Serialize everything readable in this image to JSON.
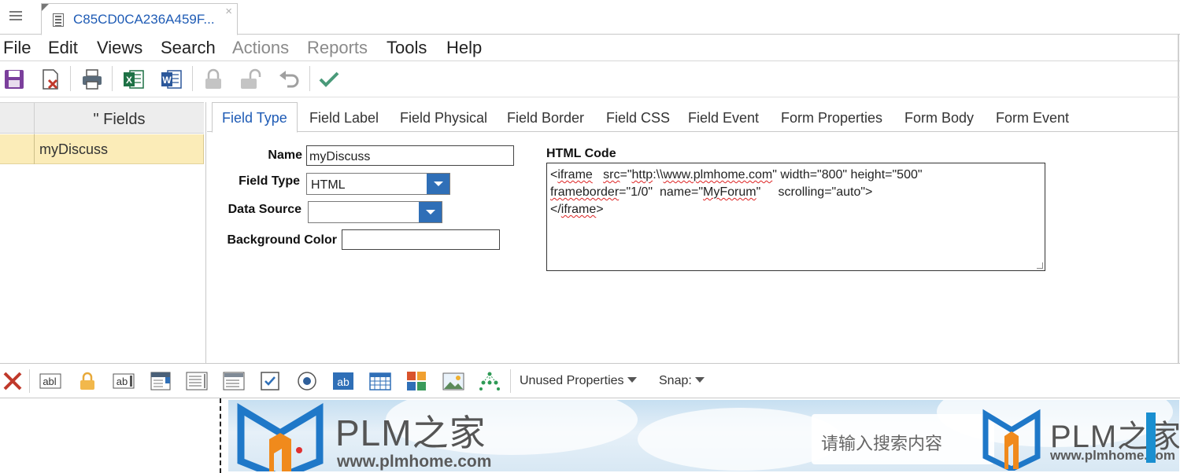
{
  "app": {
    "doc_tab_title": "C85CD0CA236A459F...",
    "close_glyph": "×"
  },
  "menu": [
    "File",
    "Edit",
    "Views",
    "Search",
    "Actions",
    "Reports",
    "Tools",
    "Help"
  ],
  "menu_disabled": [
    "Actions",
    "Reports"
  ],
  "toolbar_icons": [
    "save-icon",
    "delete-icon",
    "print-icon",
    "excel-icon",
    "word-icon",
    "lock-icon",
    "unlock-icon",
    "undo-icon",
    "check-icon"
  ],
  "fields_grid": {
    "header": "\" Fields",
    "rows": [
      "myDiscuss"
    ]
  },
  "tabs": [
    "Field Type",
    "Field Label",
    "Field Physical",
    "Field Border",
    "Field CSS",
    "Field Event",
    "Form Properties",
    "Form Body",
    "Form Event"
  ],
  "active_tab": "Field Type",
  "form": {
    "name_label": "Name",
    "name_value": "myDiscuss",
    "field_type_label": "Field Type",
    "field_type_value": "HTML",
    "data_source_label": "Data Source",
    "data_source_value": "",
    "bg_color_label": "Background Color",
    "bg_color_value": "",
    "html_code_label": "HTML Code",
    "html_code_lines": [
      "<iframe   src=\"http:\\\\www.plmhome.com\" width=\"800\" height=\"500\"",
      "frameborder=\"1/0\"  name=\"MyForum\"     scrolling=\"auto\">",
      "</iframe>"
    ]
  },
  "bottom_toolbar": {
    "icons": [
      "delete-x-icon",
      "textbox-icon",
      "lock-icon",
      "rich-text-icon",
      "listbox-icon",
      "textarea-icon",
      "combobox-icon",
      "checkbox-icon",
      "radio-icon",
      "label-ab-icon",
      "grid-icon",
      "color-tiles-icon",
      "image-icon",
      "tree-icon"
    ],
    "unused_properties": "Unused Properties",
    "snap": "Snap:"
  },
  "banner": {
    "title": "PLM之家",
    "url": "www.plmhome.com",
    "search_placeholder": "请输入搜索内容",
    "title_2": "PLM之家",
    "url_2": "www.plmhome.com"
  },
  "colors": {
    "accent": "#1e5bb5",
    "selected_row": "#fbecb8",
    "dropdown_button": "#2f6fb7"
  }
}
